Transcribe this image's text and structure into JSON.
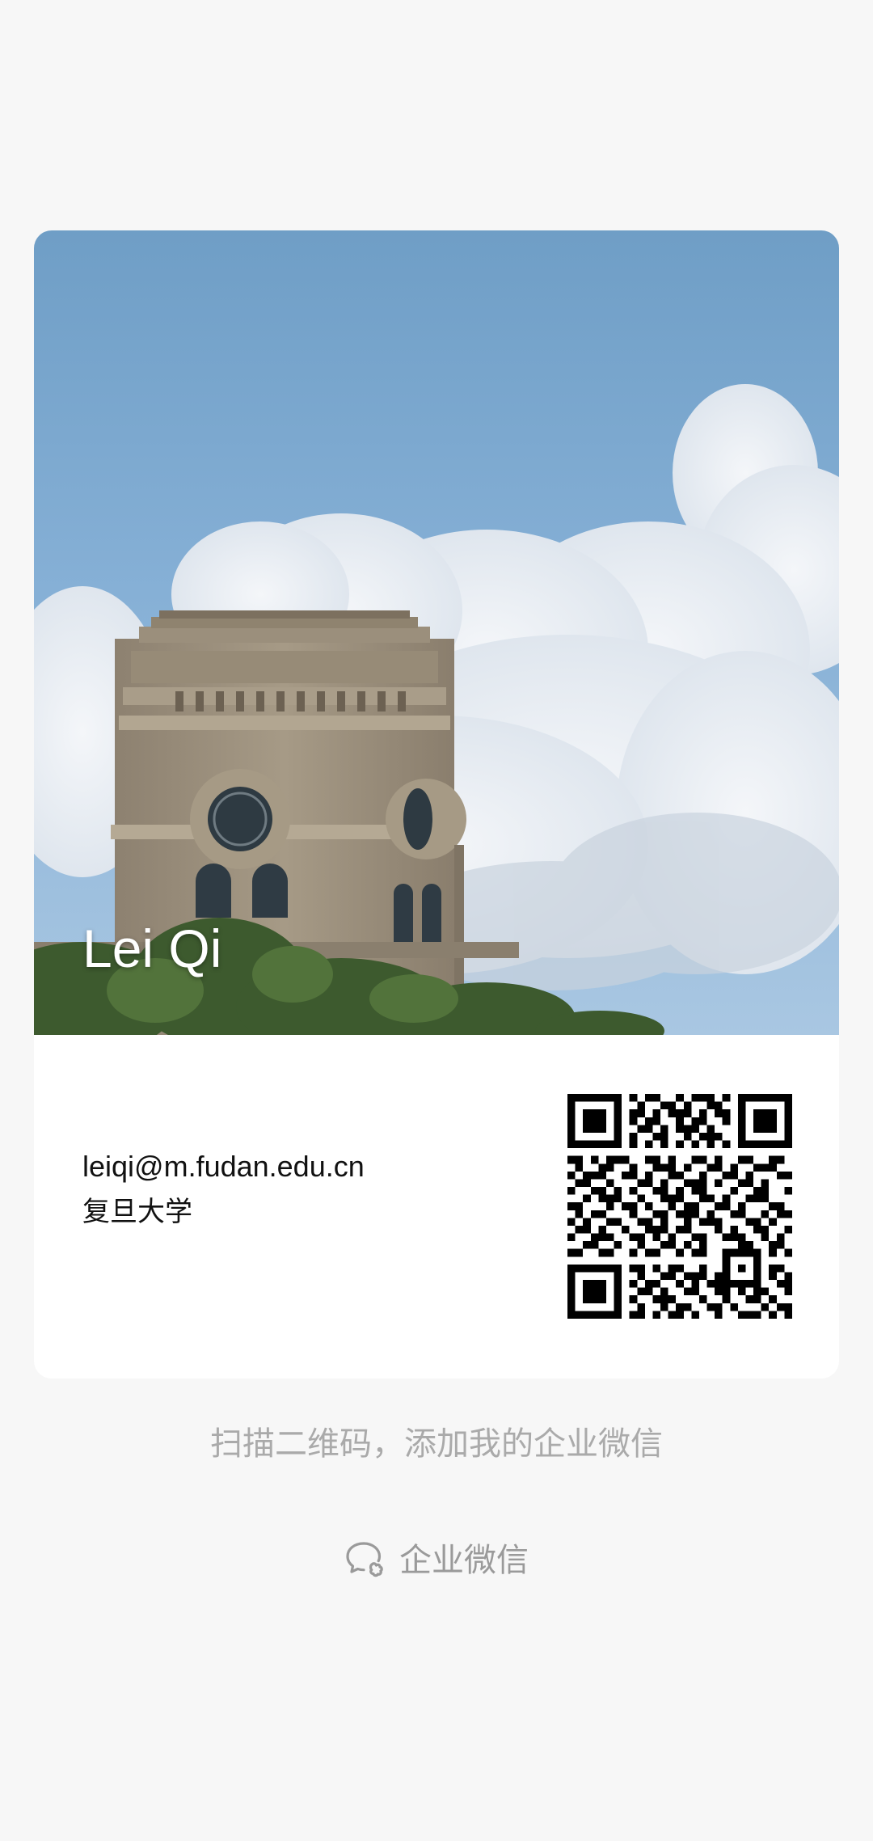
{
  "card": {
    "name": "Lei Qi",
    "email": "leiqi@m.fudan.edu.cn",
    "organization": "复旦大学",
    "photo_icon": "campus-building-photo",
    "qr_icon": "qr-code"
  },
  "hint": "扫描二维码，添加我的企业微信",
  "brand": {
    "label": "企业微信",
    "icon": "wecom-logo-icon"
  },
  "colors": {
    "background": "#f7f7f7",
    "card": "#ffffff",
    "muted_text": "#aaaaaa"
  }
}
